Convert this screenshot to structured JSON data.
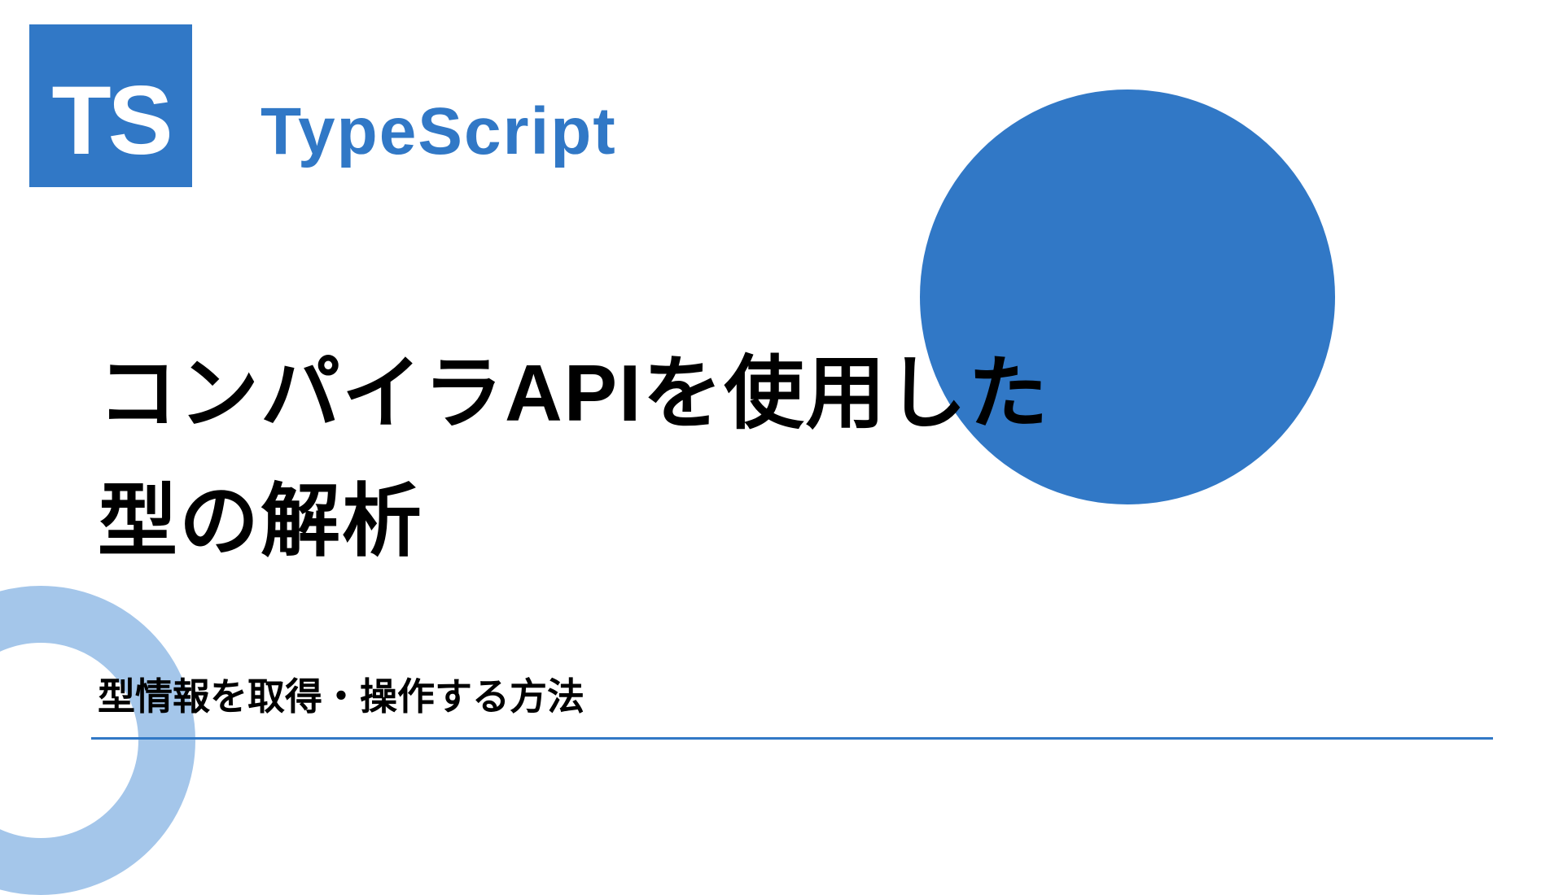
{
  "logo": {
    "text": "TS"
  },
  "brand": "TypeScript",
  "title_line1": "コンパイラAPIを使用した",
  "title_line2": "型の解析",
  "subtitle": "型情報を取得・操作する方法",
  "colors": {
    "primary": "#3178c6",
    "ring": "#a4c6ea",
    "text": "#000000",
    "background": "#ffffff"
  }
}
